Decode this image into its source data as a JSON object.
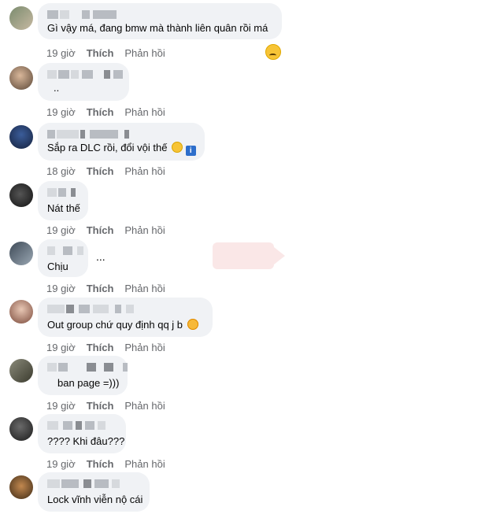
{
  "comments": [
    {
      "text": "Gì vậy má, đang bmw mà thành liên quân rồi má",
      "time": "19 giờ"
    },
    {
      "text": "..",
      "time": "19 giờ"
    },
    {
      "text": "Sắp ra DLC rồi, đổi vội thế",
      "time": "18 giờ"
    },
    {
      "text": "Nát thế",
      "time": "19 giờ"
    },
    {
      "text": "Chịu",
      "time": "19 giờ"
    },
    {
      "text": "Out group chứ quy định qq j b",
      "time": "19 giờ"
    },
    {
      "text": "ban page =)))",
      "time": "19 giờ"
    },
    {
      "text": "???? Khi đâu???",
      "time": "19 giờ"
    },
    {
      "text": "Lock vĩnh viễn nộ cái",
      "time": ""
    }
  ],
  "actions": {
    "like": "Thích",
    "reply": "Phản hồi"
  },
  "extras": {
    "ellipsis": "...",
    "info_badge": "i"
  },
  "icons": {
    "sad_reaction": "crying-face-reaction-icon",
    "smile": "slightly-smiling-face-emoji",
    "info": "information-emoji",
    "heart_face": "smiling-face-with-hearts-emoji"
  },
  "colors": {
    "bubble": "#f0f2f5",
    "meta": "#65676b",
    "text": "#050505"
  }
}
